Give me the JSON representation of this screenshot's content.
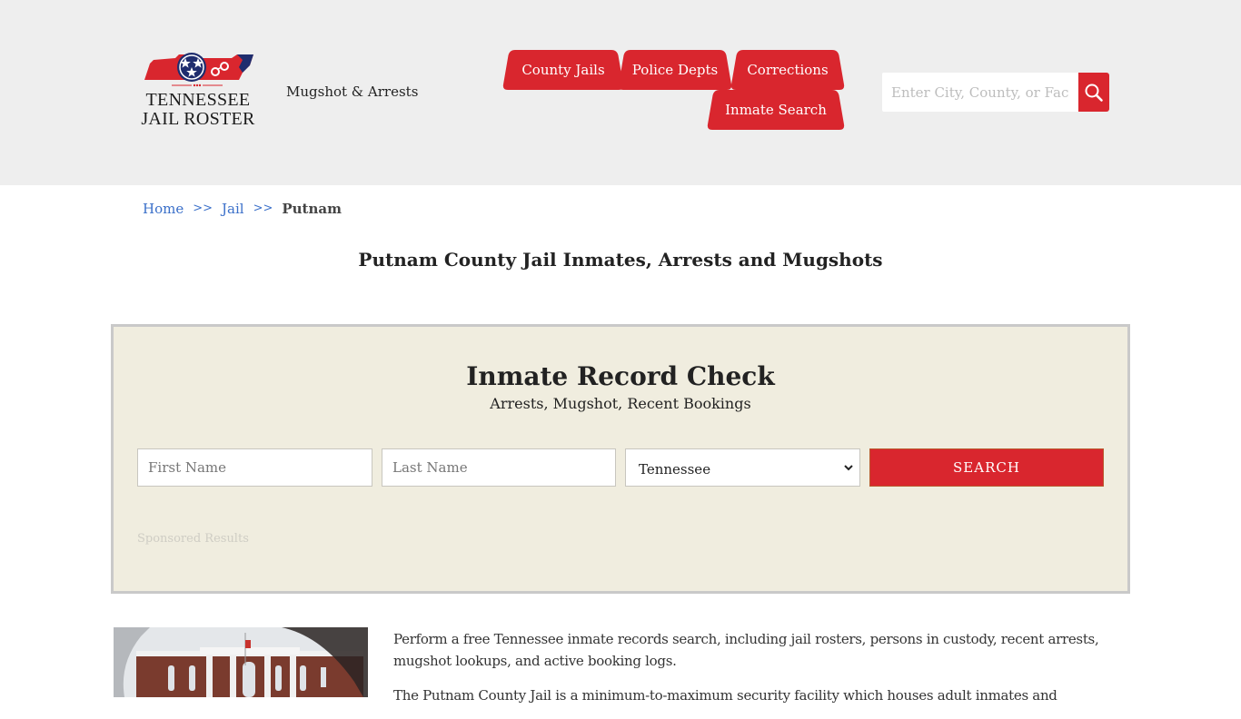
{
  "header": {
    "logo": {
      "line1": "TENNESSEE",
      "line2": "JAIL ROSTER",
      "icon": "tennessee-state-flag-handcuffs-logo"
    },
    "tagline": "Mugshot & Arrests",
    "nav": [
      {
        "label": "County Jails"
      },
      {
        "label": "Police Depts"
      },
      {
        "label": "Corrections"
      },
      {
        "label": "Inmate Search"
      }
    ],
    "search": {
      "placeholder": "Enter City, County, or Facility",
      "value": "",
      "button_icon": "search-icon"
    }
  },
  "breadcrumb": {
    "items": [
      {
        "label": "Home"
      },
      {
        "label": "Jail"
      }
    ],
    "separator": ">>",
    "current": "Putnam"
  },
  "page_title": "Putnam County Jail Inmates, Arrests and Mugshots",
  "record_check": {
    "title": "Inmate Record Check",
    "subtitle": "Arrests, Mugshot, Recent Bookings",
    "first_name_placeholder": "First Name",
    "last_name_placeholder": "Last Name",
    "state_selected": "Tennessee",
    "search_label": "SEARCH",
    "sponsored_label": "Sponsored Results"
  },
  "content": {
    "image_alt": "Putnam County Courthouse",
    "paragraphs": [
      "Perform a free Tennessee inmate records search, including jail rosters, persons in custody, recent arrests, mugshot lookups, and active booking logs.",
      "The Putnam County Jail is a minimum-to-maximum security facility which houses adult inmates and"
    ]
  },
  "colors": {
    "brand_red": "#d9262e",
    "header_bg": "#eeeeee",
    "box_bg": "#f0eddf",
    "link_blue": "#3a6fc9"
  }
}
